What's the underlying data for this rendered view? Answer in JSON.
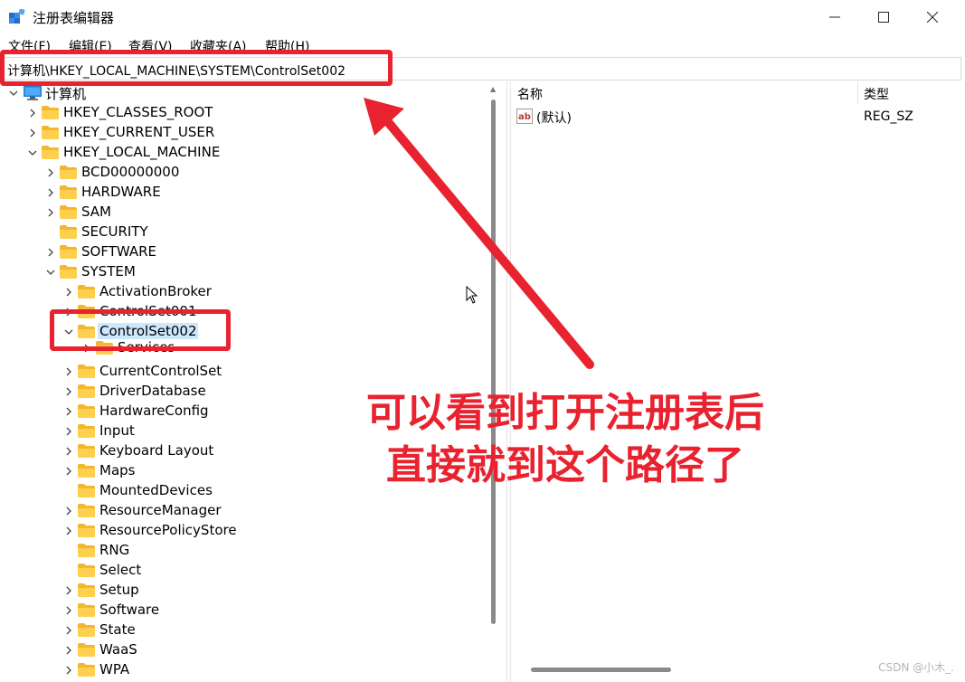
{
  "window": {
    "title": "注册表编辑器",
    "minimize_icon": "minimize-icon",
    "maximize_icon": "maximize-icon",
    "close_icon": "close-icon"
  },
  "menu": [
    "文件(F)",
    "编辑(E)",
    "查看(V)",
    "收藏夹(A)",
    "帮助(H)"
  ],
  "address": "计算机\\HKEY_LOCAL_MACHINE\\SYSTEM\\ControlSet002",
  "tree": {
    "root": "计算机",
    "hives": [
      "HKEY_CLASSES_ROOT",
      "HKEY_CURRENT_USER",
      "HKEY_LOCAL_MACHINE"
    ],
    "hklm_children": [
      "BCD00000000",
      "HARDWARE",
      "SAM",
      "SECURITY",
      "SOFTWARE",
      "SYSTEM"
    ],
    "system_children": [
      "ActivationBroker",
      "ControlSet001",
      "ControlSet002",
      "Services",
      "CurrentControlSet",
      "DriverDatabase",
      "HardwareConfig",
      "Input",
      "Keyboard Layout",
      "Maps",
      "MountedDevices",
      "ResourceManager",
      "ResourcePolicyStore",
      "RNG",
      "Select",
      "Setup",
      "Software",
      "State",
      "WaaS",
      "WPA"
    ],
    "selected": "ControlSet002"
  },
  "values_pane": {
    "columns": [
      "名称",
      "类型"
    ],
    "rows": [
      {
        "name": "(默认)",
        "type": "REG_SZ",
        "icon": "string-value-icon"
      }
    ]
  },
  "annotation": {
    "line1": "可以看到打开注册表后",
    "line2": "直接就到这个路径了",
    "color": "#e8222e"
  },
  "watermark": "CSDN @小木_."
}
